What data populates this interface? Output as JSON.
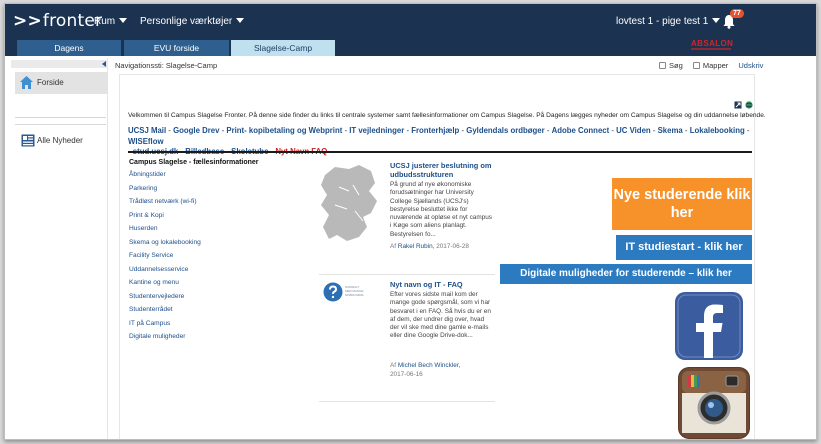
{
  "topbar": {
    "logo_text": "fronter",
    "menu_rum": "Rum",
    "menu_personlige": "Personlige værktøjer",
    "user": "lovtest 1 - pige test 1",
    "notification_count": "77"
  },
  "tabs": [
    {
      "label": "Dagens"
    },
    {
      "label": "EVU forside"
    },
    {
      "label": "Slagelse-Camp"
    }
  ],
  "brand": {
    "absalon": "ABSALON"
  },
  "sidebar": {
    "home_label": "Forside",
    "news_label": "Alle Nyheder"
  },
  "crumb": {
    "path": "Navigationssti: Slagelse-Camp",
    "sog": "Søg",
    "mapper": "Mapper",
    "udskriv": "Udskriv"
  },
  "welcome": "Velkommen til Campus Slagelse Fronter. På denne side finder du links til centrale systemer samt fællesinformationer om Campus Slagelse. På Dagens lægges nyheder om Campus Slagelse og din uddannelse løbende.",
  "quicklinks": [
    "UCSJ Mail",
    "Google Drev",
    "Print- kopibetaling og Webprint",
    "IT vejledninger",
    "Fronterhjælp",
    "Gyldendals ordbøger",
    "Adobe Connect",
    "UC Viden",
    "Skema",
    "Lokalebooking",
    "WISEflow",
    "stud.ucsj.dk",
    "Billedbase",
    "Skoletube"
  ],
  "quicklink_red": "Nyt Navn FAQ",
  "fell": {
    "title": "Campus Slagelse - fællesinformationer",
    "items": [
      "Åbningstider",
      "Parkering",
      "Trådløst netværk (wi-fi)",
      "Print & Kopi",
      "Huserden",
      "Skema og lokalebooking",
      "Facility Service",
      "Uddannelsesservice",
      "Kantine og menu",
      "Studentervejledere",
      "Studenterrådet",
      "IT på Campus",
      "Digitale muligheder"
    ]
  },
  "news": [
    {
      "title": "UCSJ justerer beslutning om udbudsstrukturen",
      "body": "På grund af nye økonomiske forudsætninger har University College Sjællands (UCSJ's) bestyrelse besluttet ikke for nuværende at opløse et nyt campus i Køge som aliens planlagt. Bestyrelsen fo...",
      "by": "Af",
      "author": "Rakel Rubin,",
      "date": "2017-06-28"
    },
    {
      "title": "Nyt navn og IT - FAQ",
      "body": "Efter vores sidste mail kom der mange gode spørgsmål, som vi har besvaret i en FAQ. Så hvis du er en af dem, der undrer dig over, hvad der vil ske med dine gamle e-mails eller dine Google Drive-dok...",
      "by": "Af",
      "author": "Michel Bech Winckler,",
      "date": "2017-06-16",
      "thumb_text": "NORMALT MED MANGE SPØRGSMÅL"
    }
  ],
  "banners": {
    "orange": "Nye studerende klik her",
    "blue1": "IT studiestart - klik her",
    "blue2": "Digitale muligheder for studerende – klik her"
  },
  "colors": {
    "topbar": "#1b3350",
    "tab": "#2f5f8e",
    "tab_active": "#bfe0ef",
    "link": "#1d4f8a",
    "orange": "#f7922a",
    "blue": "#2c7bc0",
    "facebook": "#3b5d9f",
    "absalon": "#d3242a"
  },
  "icons": [
    "home-icon",
    "news-icon",
    "bell-icon",
    "facebook-icon",
    "instagram-icon",
    "expand-icon",
    "globe-icon",
    "collapse-arrow-icon"
  ]
}
